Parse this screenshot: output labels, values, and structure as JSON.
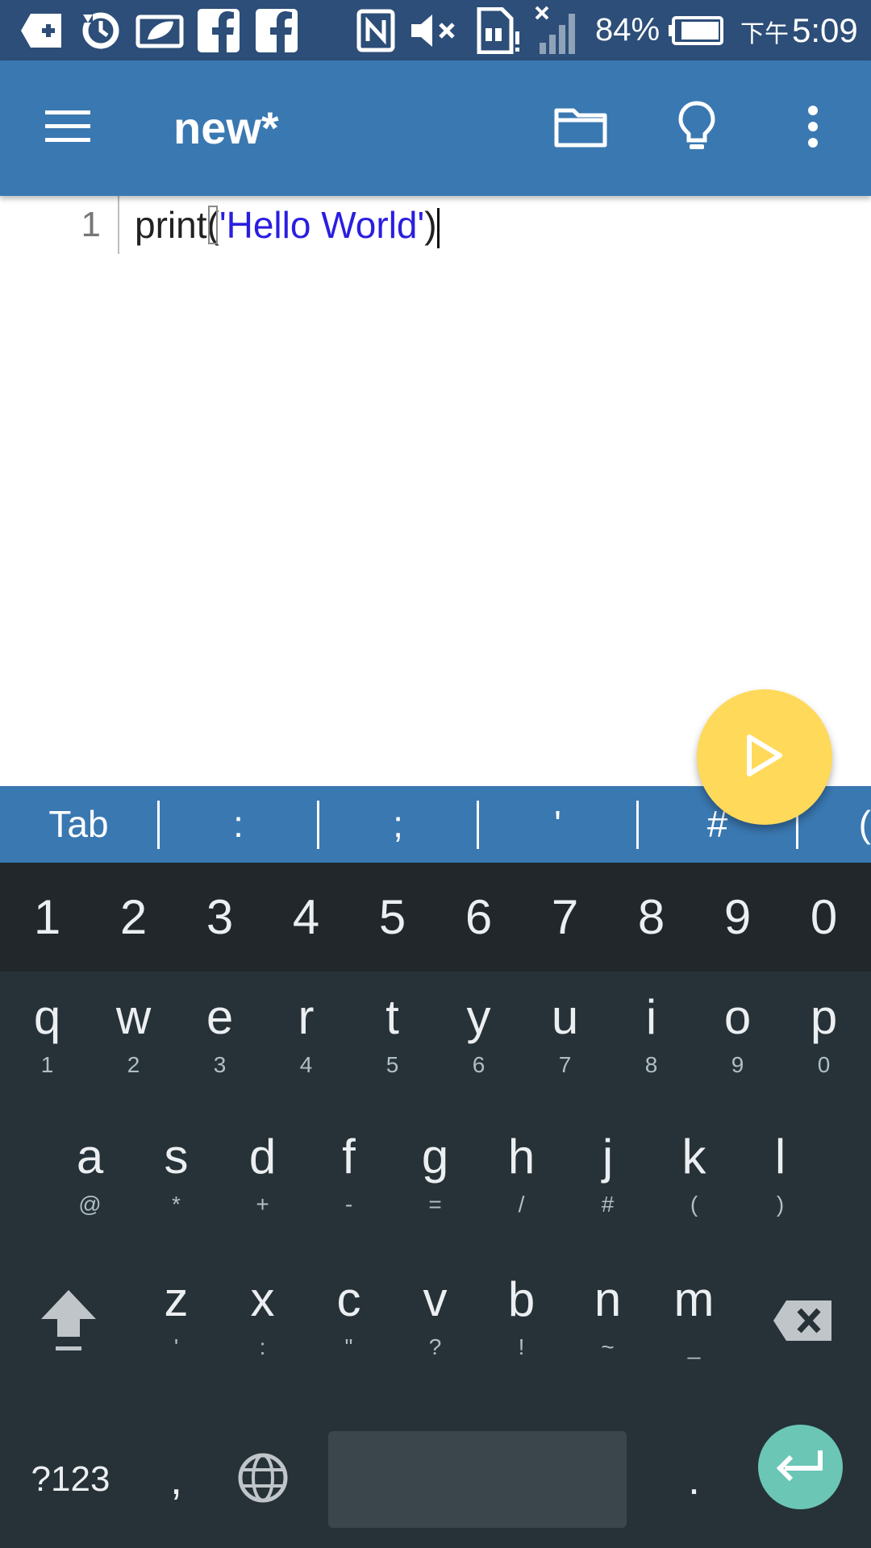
{
  "status_bar": {
    "icons": [
      "add-box-icon",
      "sync-icon",
      "leaf-icon",
      "facebook-icon",
      "facebook-icon",
      "nfc-icon",
      "volume-mute-icon",
      "sim-alert-icon",
      "signal-off-icon",
      "battery-icon"
    ],
    "battery": "84%",
    "ampm": "下午",
    "time": "5:09"
  },
  "app_bar": {
    "title": "new*",
    "icons": [
      "menu-icon",
      "folder-icon",
      "lightbulb-icon",
      "more-vert-icon"
    ]
  },
  "editor": {
    "lines": [
      {
        "number": "1",
        "func": "print",
        "open": "(",
        "string": "'Hello World'",
        "close": ")"
      }
    ]
  },
  "fab": {
    "icon": "play-icon"
  },
  "symbol_bar": [
    "Tab",
    ":",
    ";",
    "'",
    "#",
    "("
  ],
  "keyboard": {
    "numbers": [
      "1",
      "2",
      "3",
      "4",
      "5",
      "6",
      "7",
      "8",
      "9",
      "0"
    ],
    "row1": [
      {
        "key": "q",
        "hint": "1"
      },
      {
        "key": "w",
        "hint": "2"
      },
      {
        "key": "e",
        "hint": "3"
      },
      {
        "key": "r",
        "hint": "4"
      },
      {
        "key": "t",
        "hint": "5"
      },
      {
        "key": "y",
        "hint": "6"
      },
      {
        "key": "u",
        "hint": "7"
      },
      {
        "key": "i",
        "hint": "8"
      },
      {
        "key": "o",
        "hint": "9"
      },
      {
        "key": "p",
        "hint": "0"
      }
    ],
    "row2": [
      {
        "key": "a",
        "hint": "@"
      },
      {
        "key": "s",
        "hint": "*"
      },
      {
        "key": "d",
        "hint": "+"
      },
      {
        "key": "f",
        "hint": "-"
      },
      {
        "key": "g",
        "hint": "="
      },
      {
        "key": "h",
        "hint": "/"
      },
      {
        "key": "j",
        "hint": "#"
      },
      {
        "key": "k",
        "hint": "("
      },
      {
        "key": "l",
        "hint": ")"
      }
    ],
    "row3": [
      {
        "key": "z",
        "hint": "'"
      },
      {
        "key": "x",
        "hint": ":"
      },
      {
        "key": "c",
        "hint": "\""
      },
      {
        "key": "v",
        "hint": "?"
      },
      {
        "key": "b",
        "hint": "!"
      },
      {
        "key": "n",
        "hint": "~"
      },
      {
        "key": "m",
        "hint": "_"
      }
    ],
    "mode_key": "?123",
    "comma": ",",
    "period": ".",
    "colors": {
      "enter": "#6bc6b6",
      "fab": "#ffd95a",
      "app_bar": "#3a78b1"
    }
  }
}
